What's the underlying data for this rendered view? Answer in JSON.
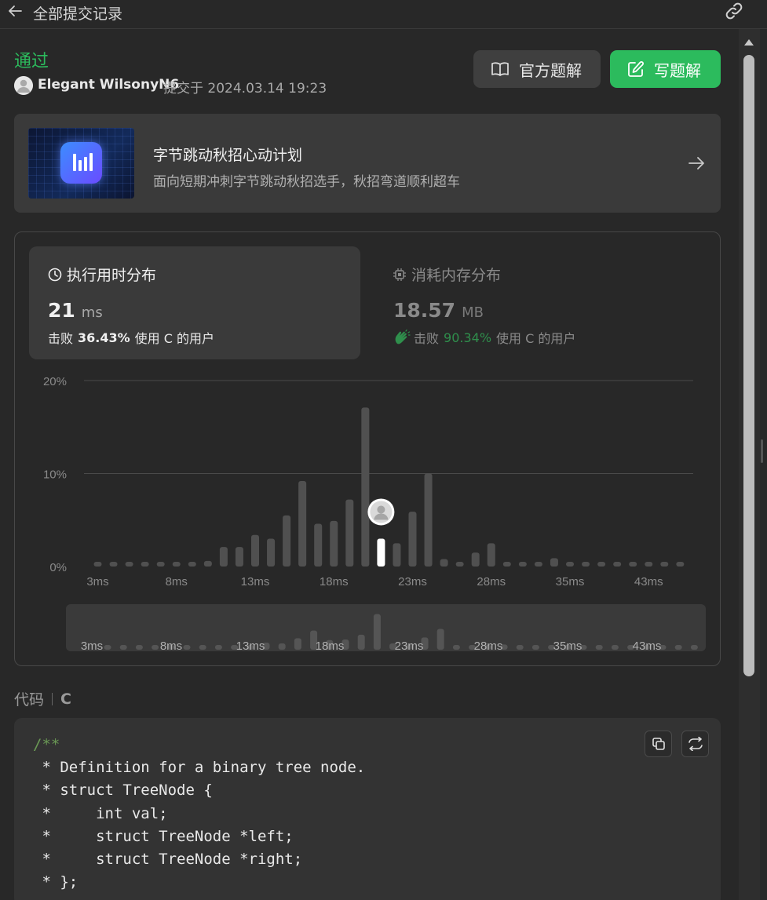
{
  "header": {
    "title": "全部提交记录",
    "back_icon": "arrow-left-icon",
    "link_icon": "link-icon"
  },
  "submission": {
    "status": "通过",
    "status_color": "#2cbb5d",
    "username": "Elegant WilsonyN6",
    "submitted_at": "提交于 2024.03.14 19:23"
  },
  "buttons": {
    "official": "官方题解",
    "write": "写题解"
  },
  "promo": {
    "title": "字节跳动秋招心动计划",
    "subtitle": "面向短期冲刺字节跳动秋招选手，秋招弯道顺利超车"
  },
  "stats": {
    "runtime": {
      "tab_label": "执行用时分布",
      "value": "21",
      "unit": "ms",
      "beats_prefix": "击败",
      "beats_pct": "36.43%",
      "beats_suffix": "使用 C 的用户"
    },
    "memory": {
      "tab_label": "消耗内存分布",
      "value": "18.57",
      "unit": "MB",
      "beats_prefix": "击败",
      "beats_pct": "90.34%",
      "beats_suffix": "使用 C 的用户"
    }
  },
  "chart_data": {
    "type": "bar",
    "title": "",
    "xlabel": "",
    "ylabel": "",
    "y_ticks": [
      "20%",
      "10%",
      "0%"
    ],
    "ylim": [
      0,
      20
    ],
    "x_tick_labels": [
      "3ms",
      "8ms",
      "13ms",
      "18ms",
      "23ms",
      "28ms",
      "35ms",
      "43ms"
    ],
    "x_tick_bar_index": [
      0,
      5,
      10,
      15,
      20,
      25,
      30,
      35
    ],
    "values": [
      0.5,
      0.5,
      0.5,
      0.5,
      0.5,
      0.5,
      0.5,
      0.6,
      2.1,
      2.1,
      3.4,
      3.0,
      5.5,
      9.2,
      4.6,
      4.9,
      7.2,
      17.1,
      3.0,
      2.5,
      5.9,
      10.0,
      0.8,
      0.5,
      1.5,
      2.5,
      0.5,
      0.5,
      0.5,
      0.9,
      0.5,
      0.5,
      0.5,
      0.5,
      0.5,
      0.5,
      0.5,
      0.5
    ],
    "highlight_index": 18,
    "grid": true
  },
  "code": {
    "label": "代码",
    "language": "C",
    "lines": [
      {
        "text": "/**",
        "comment": true
      },
      {
        "text": " * Definition for a binary tree node.",
        "comment": false
      },
      {
        "text": " * struct TreeNode {",
        "comment": false
      },
      {
        "text": " *     int val;",
        "comment": false
      },
      {
        "text": " *     struct TreeNode *left;",
        "comment": false
      },
      {
        "text": " *     struct TreeNode *right;",
        "comment": false
      },
      {
        "text": " * };",
        "comment": false
      }
    ]
  }
}
